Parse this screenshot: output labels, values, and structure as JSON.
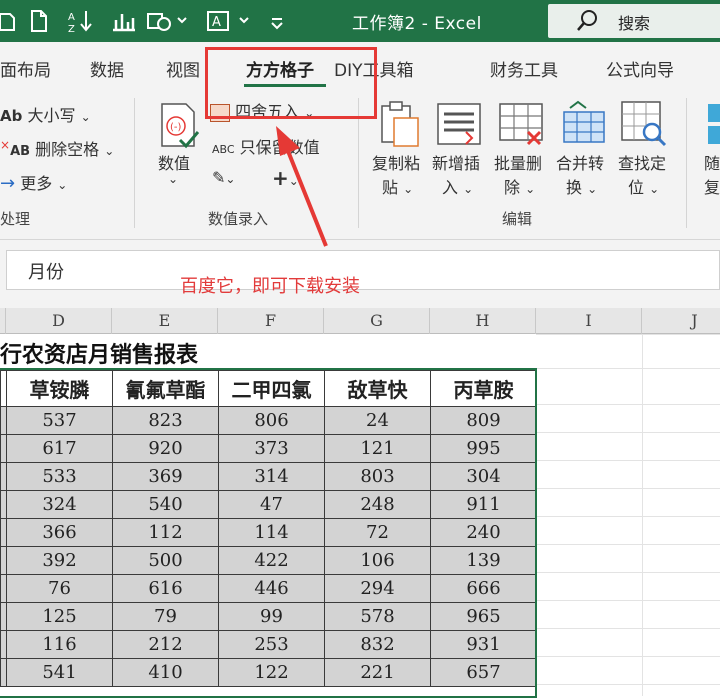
{
  "titlebar": {
    "title": "工作簿2  -  Excel",
    "search_label": "搜索"
  },
  "tabs": [
    "面布局",
    "数据",
    "视图",
    "方方格子",
    "DIY工具箱",
    "财务工具",
    "公式向导"
  ],
  "active_tab": "方方格子",
  "ribbon": {
    "text_group": {
      "case_label": "大小写",
      "case_prefix": "Ab",
      "trim_label": "删除空格",
      "trim_prefix": "AB",
      "more_label": "更多",
      "group_label": "处理"
    },
    "value_group": {
      "value_label": "数值",
      "round_label": "四舍五入",
      "keep_value_label": "只保留数值",
      "keep_value_prefix": "ABC",
      "group_label": "数值录入"
    },
    "edit_group": {
      "buttons": [
        {
          "top": "复制粘",
          "bottom": "贴"
        },
        {
          "top": "新增插",
          "bottom": "入"
        },
        {
          "top": "批量删",
          "bottom": "除"
        },
        {
          "top": "合并转",
          "bottom": "换"
        },
        {
          "top": "查找定",
          "bottom": "位"
        }
      ],
      "partial_top": "随",
      "partial_bottom": "复",
      "group_label": "编辑"
    }
  },
  "formula_bar": {
    "value": "月份"
  },
  "annotation": "百度它，即可下载安装",
  "columns": [
    "D",
    "E",
    "F",
    "G",
    "H",
    "I",
    "J"
  ],
  "sheet": {
    "title": "行农资店月销售报表",
    "headers": [
      "草铵膦",
      "氰氟草酯",
      "二甲四氯",
      "敌草快",
      "丙草胺"
    ],
    "rows": [
      [
        "537",
        "823",
        "806",
        "24",
        "809"
      ],
      [
        "617",
        "920",
        "373",
        "121",
        "995"
      ],
      [
        "533",
        "369",
        "314",
        "803",
        "304"
      ],
      [
        "324",
        "540",
        "47",
        "248",
        "911"
      ],
      [
        "366",
        "112",
        "114",
        "72",
        "240"
      ],
      [
        "392",
        "500",
        "422",
        "106",
        "139"
      ],
      [
        "76",
        "616",
        "446",
        "294",
        "666"
      ],
      [
        "125",
        "79",
        "99",
        "578",
        "965"
      ],
      [
        "116",
        "212",
        "253",
        "832",
        "931"
      ],
      [
        "541",
        "410",
        "122",
        "221",
        "657"
      ]
    ]
  },
  "colors": {
    "excel_green": "#217346",
    "annotation_red": "#e53935",
    "cell_fill": "#d3d3d3"
  }
}
